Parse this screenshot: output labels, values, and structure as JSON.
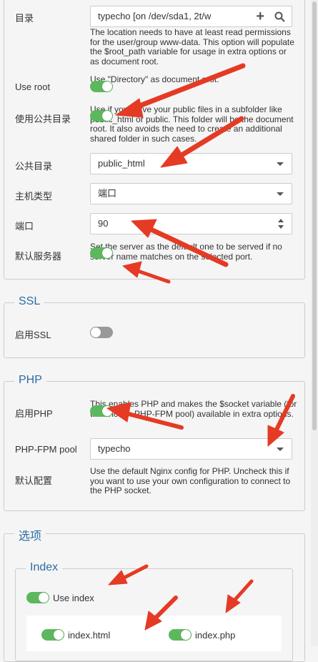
{
  "form": {
    "directory": {
      "label": "目录",
      "value": "typecho [on /dev/sda1, 2t/w",
      "help": "The location needs to have at least read permissions for the user/group www-data. This option will populate the $root_path variable for usage in extra options or as document root."
    },
    "use_root": {
      "label": "Use root",
      "help": "Use \"Directory\" as document root.",
      "enabled": true
    },
    "use_public": {
      "label": "使用公共目录",
      "help": "Use if you serve your public files in a subfolder like public_html or public. This folder will be the document root. It also avoids the need to create an additional shared folder in such cases.",
      "enabled": true
    },
    "public_dir": {
      "label": "公共目录",
      "value": "public_html"
    },
    "host_type": {
      "label": "主机类型",
      "value": "端口"
    },
    "port": {
      "label": "端口",
      "value": "90"
    },
    "default_server": {
      "label": "默认服务器",
      "help": "Set the server as the default one to be served if no server name matches on the selected port.",
      "enabled": true
    }
  },
  "ssl": {
    "legend": "SSL",
    "enable": {
      "label": "启用SSL",
      "enabled": false
    }
  },
  "php": {
    "legend": "PHP",
    "enable": {
      "label": "启用PHP",
      "help": "This enables PHP and makes the $socket variable (for the chosen PHP-FPM pool) available in extra options.",
      "enabled": true
    },
    "pool": {
      "label": "PHP-FPM pool",
      "value": "typecho"
    },
    "default_config": {
      "label": "默认配置",
      "help": "Use the default Nginx config for PHP. Uncheck this if you want to use your own configuration to connect to the PHP socket.",
      "enabled": true
    }
  },
  "options": {
    "legend": "选项",
    "index": {
      "legend": "Index",
      "use_index": {
        "label": "Use index",
        "enabled": true
      },
      "files": [
        {
          "label": "index.html",
          "enabled": true
        },
        {
          "label": "index.php",
          "enabled": true
        }
      ]
    }
  },
  "icons": {
    "add": "plus-icon",
    "search": "search-icon",
    "dropdown": "chevron-down-icon",
    "spinner": "spinner-arrows-icon"
  },
  "colors": {
    "accent": "#2d6ca2",
    "toggle_on": "#5cb85c",
    "toggle_off": "#999999",
    "annotation_arrow": "#e53a24"
  }
}
